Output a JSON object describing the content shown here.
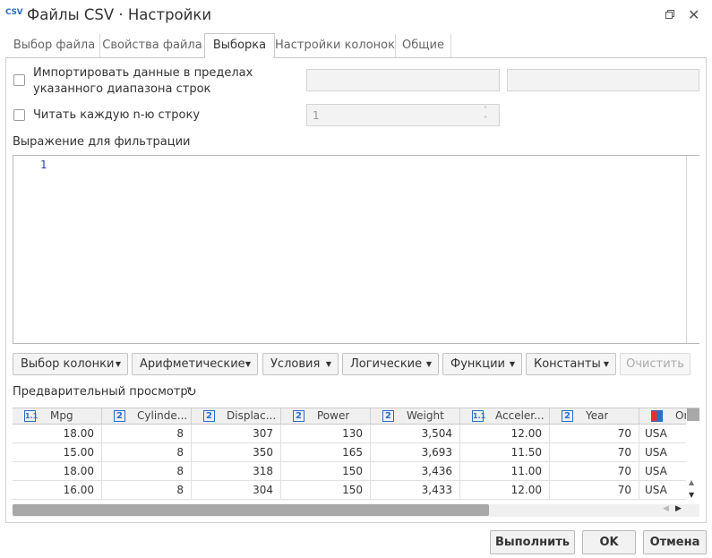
{
  "window": {
    "logo": "CSV",
    "title": "Файлы CSV · Настройки"
  },
  "tabs": [
    {
      "label": "Выбор файла",
      "active": false
    },
    {
      "label": "Свойства файла",
      "active": false
    },
    {
      "label": "Выборка",
      "active": true
    },
    {
      "label": "Настройки колонок",
      "active": false
    },
    {
      "label": "Общие",
      "active": false
    }
  ],
  "range": {
    "label": "Импортировать данные в пределах указанного диапазона строк",
    "label_line1": "Импортировать данные в пределах",
    "label_line2": "указанного диапазона строк",
    "checked": false,
    "from_value": "",
    "to_value": ""
  },
  "nth": {
    "label": "Читать каждую n-ю строку",
    "checked": false,
    "value": "1"
  },
  "filter": {
    "label": "Выражение для фильтрации",
    "line_number": "1",
    "text": ""
  },
  "toolbar": {
    "buttons": [
      {
        "label": "Выбор колонки"
      },
      {
        "label": "Арифметические"
      },
      {
        "label": "Условия"
      },
      {
        "label": "Логические"
      },
      {
        "label": "Функции"
      },
      {
        "label": "Константы"
      }
    ],
    "clear_label": "Очистить"
  },
  "preview": {
    "title": "Предварительный просмотр",
    "columns": [
      {
        "label": "Mpg",
        "type_icon": "1.1"
      },
      {
        "label": "Cylinde...",
        "type_icon": "2"
      },
      {
        "label": "Displac...",
        "type_icon": "2"
      },
      {
        "label": "Power",
        "type_icon": "2"
      },
      {
        "label": "Weight",
        "type_icon": "2"
      },
      {
        "label": "Acceler...",
        "type_icon": "1.1"
      },
      {
        "label": "Year",
        "type_icon": "2"
      },
      {
        "label": "Or",
        "type_icon": "table"
      }
    ],
    "rows": [
      [
        "18.00",
        "8",
        "307",
        "130",
        "3,504",
        "12.00",
        "70",
        "USA"
      ],
      [
        "15.00",
        "8",
        "350",
        "165",
        "3,693",
        "11.50",
        "70",
        "USA"
      ],
      [
        "18.00",
        "8",
        "318",
        "150",
        "3,436",
        "11.00",
        "70",
        "USA"
      ],
      [
        "16.00",
        "8",
        "304",
        "150",
        "3,433",
        "12.00",
        "70",
        "USA"
      ]
    ]
  },
  "footer": {
    "run_label": "Выполнить",
    "ok_label": "OK",
    "cancel_label": "Отмена"
  },
  "colors": {
    "accent": "#2a6fc9",
    "border": "#c9c9c9"
  }
}
